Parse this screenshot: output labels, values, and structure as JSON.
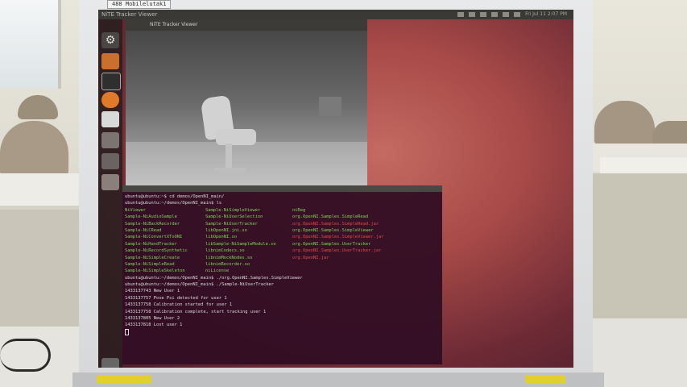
{
  "bezel": {
    "label": "488 Mobilelutak1",
    "sticker_left": "",
    "sticker_right": ""
  },
  "topbar": {
    "title": "NiTE Tracker Viewer",
    "clock": "Fri Jul 11 2:07 PM",
    "icons": [
      "keyboard-icon",
      "network-icon",
      "bluetooth-icon",
      "mail-icon",
      "battery-icon",
      "volume-icon"
    ]
  },
  "viewer": {
    "title": "NiTE Tracker Viewer"
  },
  "launcher": {
    "items": [
      "dash-home-icon",
      "files-icon",
      "terminal-icon",
      "firefox-icon",
      "document-icon",
      "app-icon",
      "app-icon",
      "app-icon",
      "trash-icon"
    ]
  },
  "terminal": {
    "pre_lines": [
      "ubuntu@ubuntu:~$ cd demos/OpenNI_main/",
      "ubuntu@ubuntu:~/demos/OpenNI_main$ ls"
    ],
    "ls_rows": [
      [
        {
          "t": "NiViewer",
          "c": "g"
        },
        {
          "t": "Sample-NiSimpleViewer",
          "c": "g"
        },
        {
          "t": "niReg",
          "c": "g"
        }
      ],
      [
        {
          "t": "Sample-NiAudioSample",
          "c": "g"
        },
        {
          "t": "Sample-NiUserSelection",
          "c": "g"
        },
        {
          "t": "org.OpenNI.Samples.SimpleRead",
          "c": "g"
        }
      ],
      [
        {
          "t": "Sample-NiBackRecorder",
          "c": "g"
        },
        {
          "t": "Sample-NiUserTracker",
          "c": "g"
        },
        {
          "t": "org.OpenNI.Samples.SimpleRead.jar",
          "c": "r"
        }
      ],
      [
        {
          "t": "Sample-NiCRead",
          "c": "g"
        },
        {
          "t": "libOpenNI.jni.so",
          "c": "g"
        },
        {
          "t": "org.OpenNI.Samples.SimpleViewer",
          "c": "g"
        }
      ],
      [
        {
          "t": "Sample-NiConvertXToONI",
          "c": "g"
        },
        {
          "t": "libOpenNI.so",
          "c": "g"
        },
        {
          "t": "org.OpenNI.Samples.SimpleViewer.jar",
          "c": "r"
        }
      ],
      [
        {
          "t": "Sample-NiHandTracker",
          "c": "g"
        },
        {
          "t": "libSample-NiSampleModule.so",
          "c": "g"
        },
        {
          "t": "org.OpenNI.Samples.UserTracker",
          "c": "g"
        }
      ],
      [
        {
          "t": "Sample-NiRecordSynthetic",
          "c": "g"
        },
        {
          "t": "libnimCodecs.so",
          "c": "g"
        },
        {
          "t": "org.OpenNI.Samples.UserTracker.jar",
          "c": "r"
        }
      ],
      [
        {
          "t": "Sample-NiSimpleCreate",
          "c": "g"
        },
        {
          "t": "libnimMockNodes.so",
          "c": "g"
        },
        {
          "t": "org.OpenNI.jar",
          "c": "r"
        }
      ],
      [
        {
          "t": "Sample-NiSimpleRead",
          "c": "g"
        },
        {
          "t": "libnimRecorder.so",
          "c": "g"
        },
        {
          "t": "",
          "c": "w"
        }
      ],
      [
        {
          "t": "Sample-NiSimpleSkeleton",
          "c": "g"
        },
        {
          "t": "niLicense",
          "c": "g"
        },
        {
          "t": "",
          "c": "w"
        }
      ]
    ],
    "post_lines": [
      "ubuntu@ubuntu:~/demos/OpenNI_main$ ./org.OpenNI.Samples.SimpleViewer",
      "ubuntu@ubuntu:~/demos/OpenNI_main$ ./Sample-NiUserTracker",
      "1433137743 New User 1",
      "1433137757 Pose Psi detected for user 1",
      "1433137758 Calibration started for user 1",
      "1433137758 Calibration complete, start tracking user 1",
      "1433137805 New User 2",
      "1433137818 Lost user 1"
    ]
  }
}
